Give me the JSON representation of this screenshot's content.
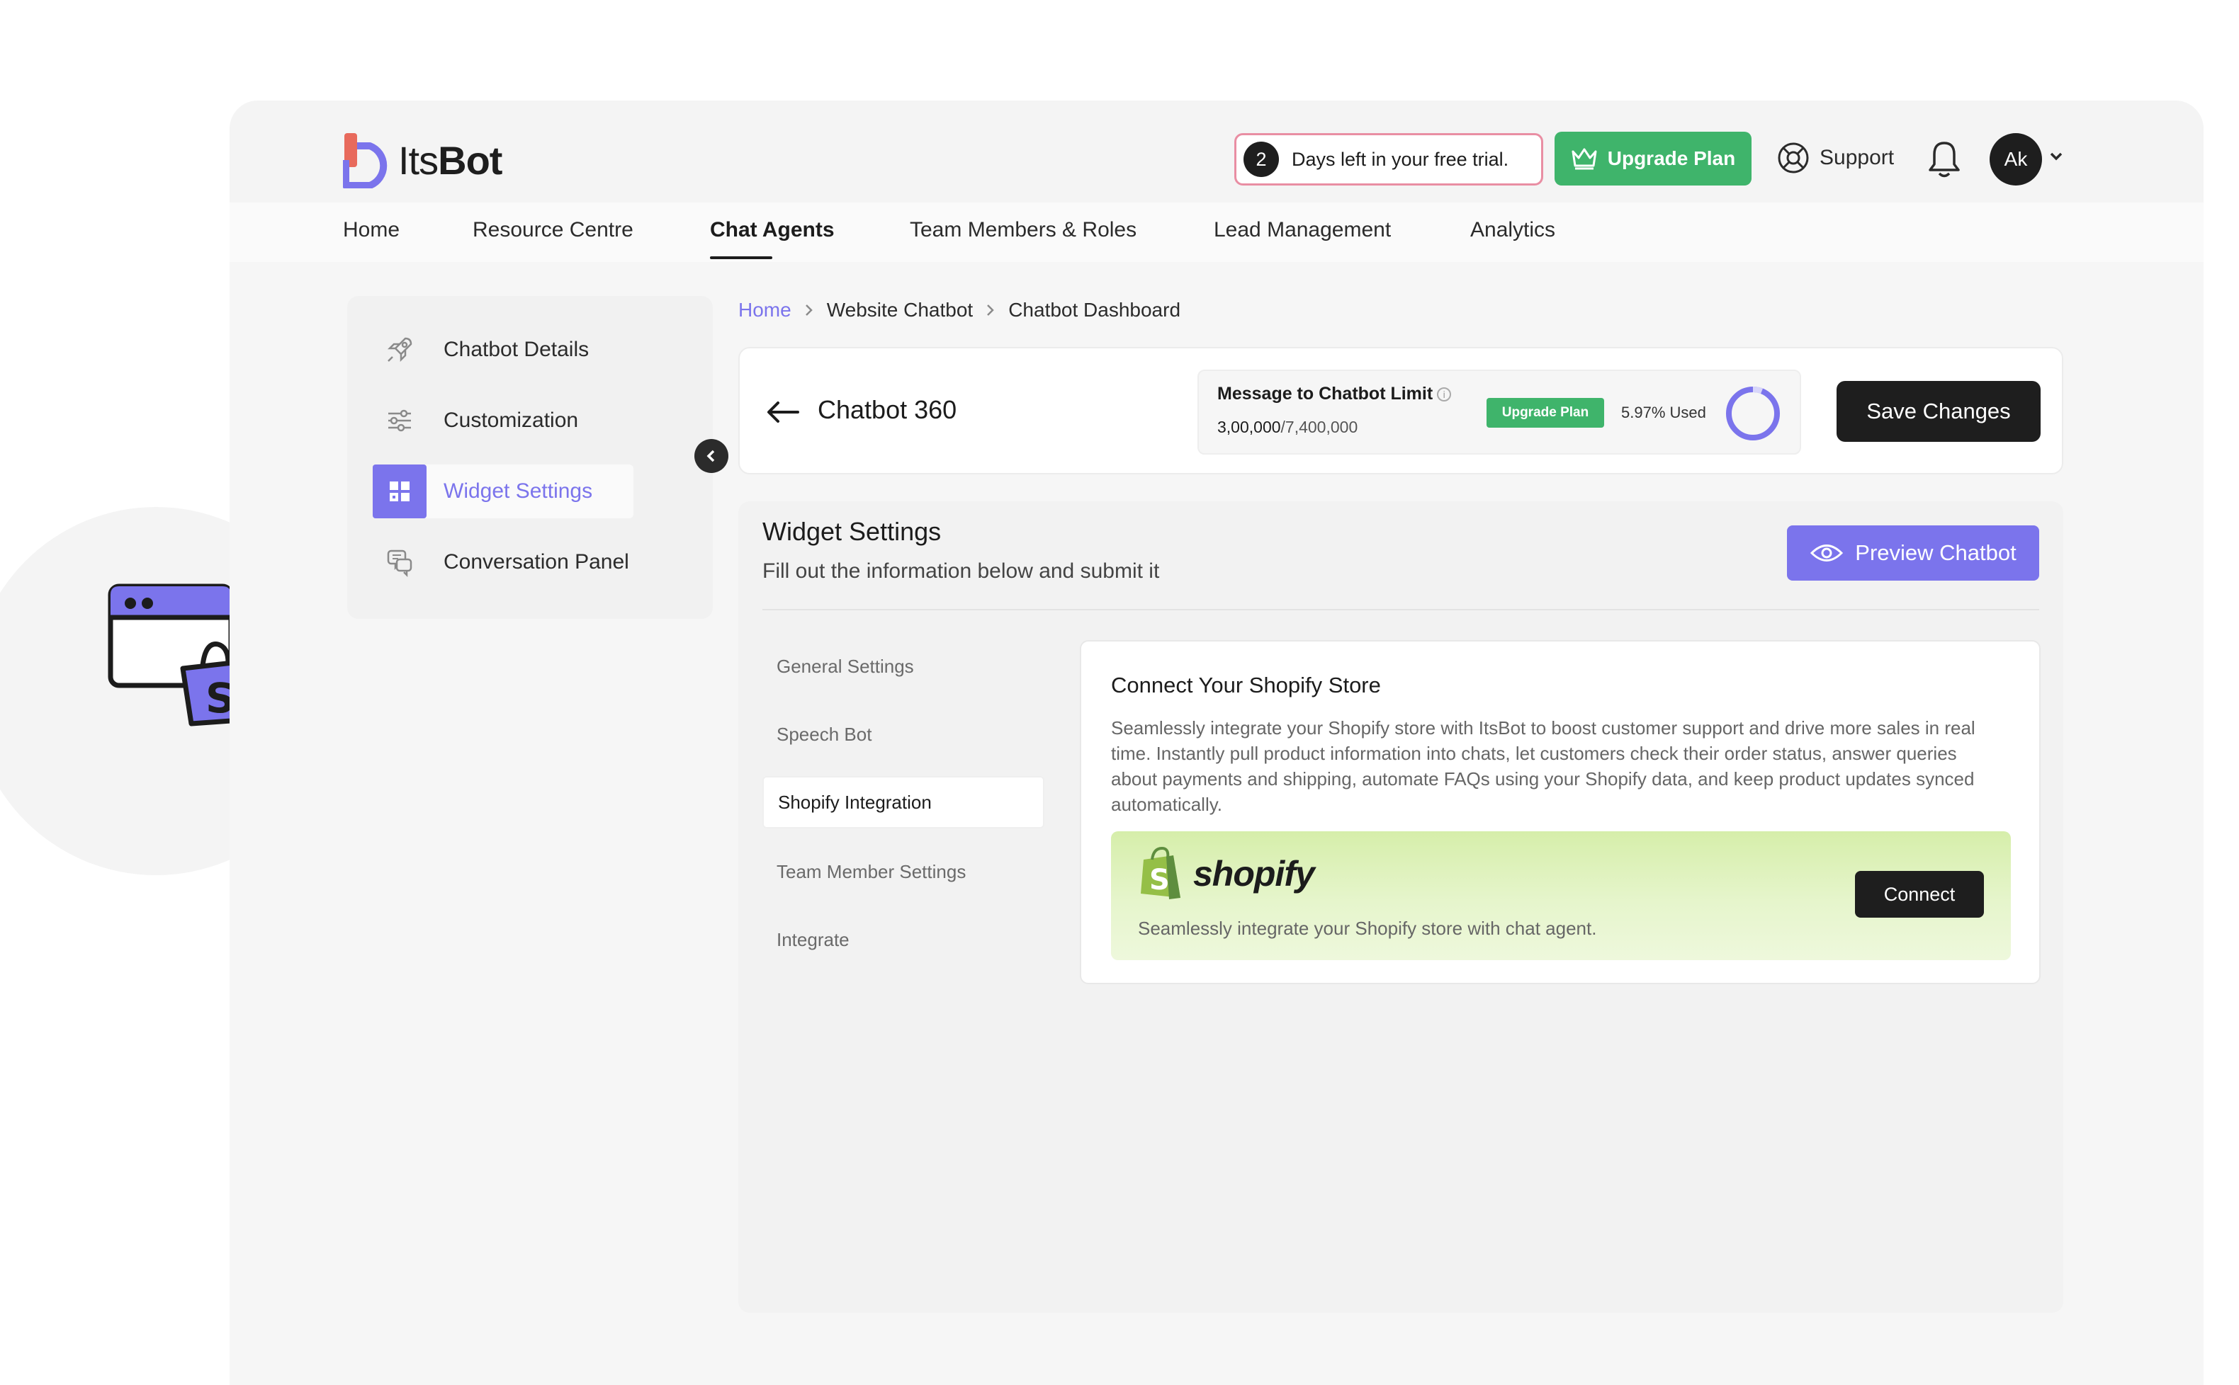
{
  "brand": {
    "name_light": "Its",
    "name_bold": "Bot"
  },
  "topbar": {
    "trial_days": "2",
    "trial_text": "Days left in your free trial.",
    "upgrade_label": "Upgrade Plan",
    "support_label": "Support",
    "avatar_initials": "Ak"
  },
  "nav": {
    "items": [
      "Home",
      "Resource Centre",
      "Chat Agents",
      "Team Members & Roles",
      "Lead Management",
      "Analytics"
    ],
    "active": "Chat Agents"
  },
  "sidebar": {
    "items": [
      {
        "label": "Chatbot Details",
        "icon": "rocket-icon"
      },
      {
        "label": "Customization",
        "icon": "sliders-icon"
      },
      {
        "label": "Widget Settings",
        "icon": "widget-grid-icon",
        "active": true
      },
      {
        "label": "Conversation Panel",
        "icon": "chat-bubbles-icon"
      }
    ]
  },
  "breadcrumb": {
    "home": "Home",
    "middle": "Website Chatbot",
    "current": "Chatbot Dashboard"
  },
  "header": {
    "title": "Chatbot 360",
    "limit": {
      "title": "Message to Chatbot Limit",
      "used": "3,00,000",
      "total": "/7,400,000",
      "upgrade_label": "Upgrade Plan",
      "used_percent_label": "5.97% Used",
      "used_fraction": 0.0597
    },
    "save_label": "Save Changes"
  },
  "widget": {
    "title": "Widget Settings",
    "subtitle": "Fill out the information below and submit it",
    "preview_label": "Preview Chatbot",
    "tabs": [
      "General Settings",
      "Speech Bot",
      "Shopify Integration",
      "Team Member Settings",
      "Integrate"
    ],
    "active_tab": "Shopify Integration"
  },
  "shopify": {
    "title": "Connect Your Shopify Store",
    "description": "Seamlessly integrate your Shopify store with ItsBot to boost customer support and drive more sales in real time. Instantly pull product information into chats, let customers check their order status, answer queries about payments and shipping, automate FAQs using your Shopify data, and keep product updates synced automatically.",
    "logo_text": "shopify",
    "banner_text": "Seamlessly integrate your Shopify store with chat agent.",
    "connect_label": "Connect"
  },
  "colors": {
    "accent": "#7b74ec",
    "green": "#3fb46b",
    "dark": "#1e1e1e",
    "trial_border": "#e98ea3"
  }
}
